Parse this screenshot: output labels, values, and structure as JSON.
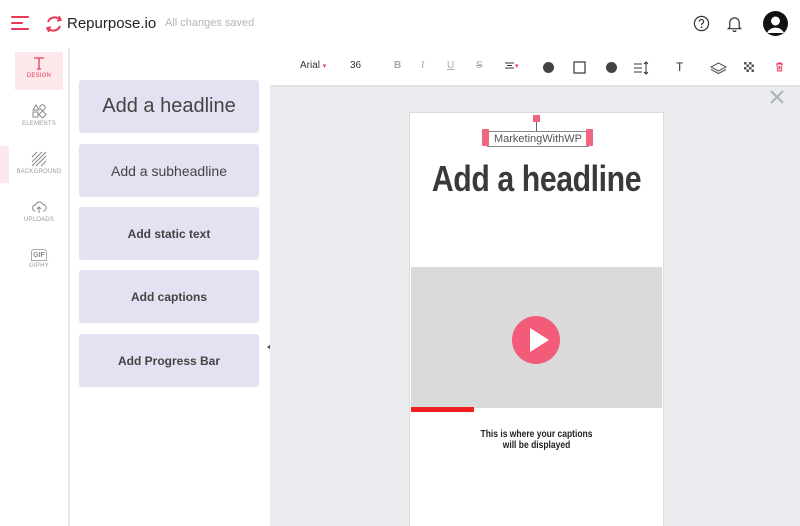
{
  "header": {
    "brand": "Repurpose.io",
    "status": "All changes saved"
  },
  "rail": {
    "items": [
      {
        "label": "DESIGN",
        "icon": "text-t-icon",
        "active": true
      },
      {
        "label": "ELEMENTS",
        "icon": "shapes-icon"
      },
      {
        "label": "BACKGROUND",
        "icon": "hatch-icon"
      },
      {
        "label": "UPLOADS",
        "icon": "cloud-upload-icon"
      },
      {
        "label": "GIPHY",
        "icon": "gif-icon",
        "badge": "GIF"
      }
    ]
  },
  "panel": {
    "headline": "Add a headline",
    "subheadline": "Add a subheadline",
    "static_text": "Add static text",
    "captions": "Add captions",
    "progress_bar": "Add Progress Bar"
  },
  "toolbar": {
    "font": "Arial",
    "size": "36",
    "bold": "B",
    "italic": "I",
    "underline": "U",
    "strike": "S",
    "text_tool": "T"
  },
  "canvas": {
    "watermark": "MarketingWithWP",
    "headline": "Add a headline",
    "caption_line1": "This is where your captions",
    "caption_line2": "will be displayed",
    "progress_fraction": 0.25
  },
  "colors": {
    "accent": "#e8385a",
    "panel_button": "#e4e2f2",
    "progress_bar": "#ef1f1f",
    "play_button": "#f25c7a"
  }
}
